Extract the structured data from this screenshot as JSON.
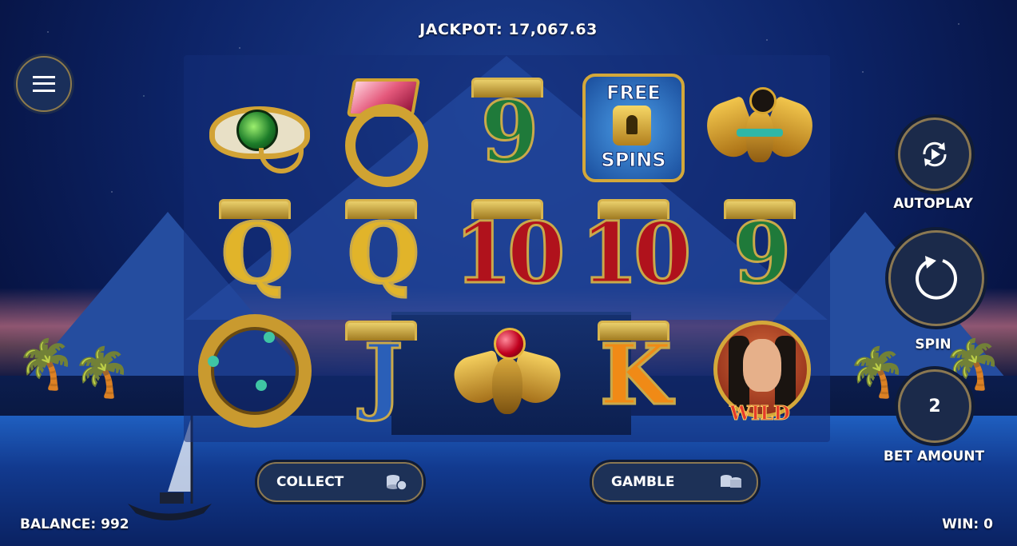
{
  "hud": {
    "jackpot_label": "JACKPOT:",
    "jackpot_value": "17,067.63",
    "balance_label": "BALANCE:",
    "balance_value": "992",
    "win_label": "WIN:",
    "win_value": "0"
  },
  "controls": {
    "menu_icon": "hamburger-menu-icon",
    "autoplay_label": "AUTOPLAY",
    "spin_label": "SPIN",
    "bet_amount_label": "BET AMOUNT",
    "bet_amount_value": "2",
    "collect_label": "COLLECT",
    "gamble_label": "GAMBLE"
  },
  "reels": {
    "rows": [
      [
        "eye-of-horus",
        "pink-gem-ring",
        "9",
        "free-spins",
        "winged-scarab-collar"
      ],
      [
        "Q",
        "Q",
        "10",
        "10",
        "9"
      ],
      [
        "serpent-ring",
        "J",
        "red-jewel-scarab",
        "K",
        "cleopatra-wild"
      ]
    ],
    "symbol_text": {
      "free_spins_top": "FREE",
      "free_spins_bottom": "SPINS",
      "wild": "WILD",
      "r1c3": "9",
      "r2c1": "Q",
      "r2c2": "Q",
      "r2c3": "10",
      "r2c4": "10",
      "r2c5": "9",
      "r3c2": "J",
      "r3c4": "K"
    }
  },
  "colors": {
    "gold": "#d4a83a",
    "panel": "#1b2a4a",
    "sky": "#0d2468"
  }
}
